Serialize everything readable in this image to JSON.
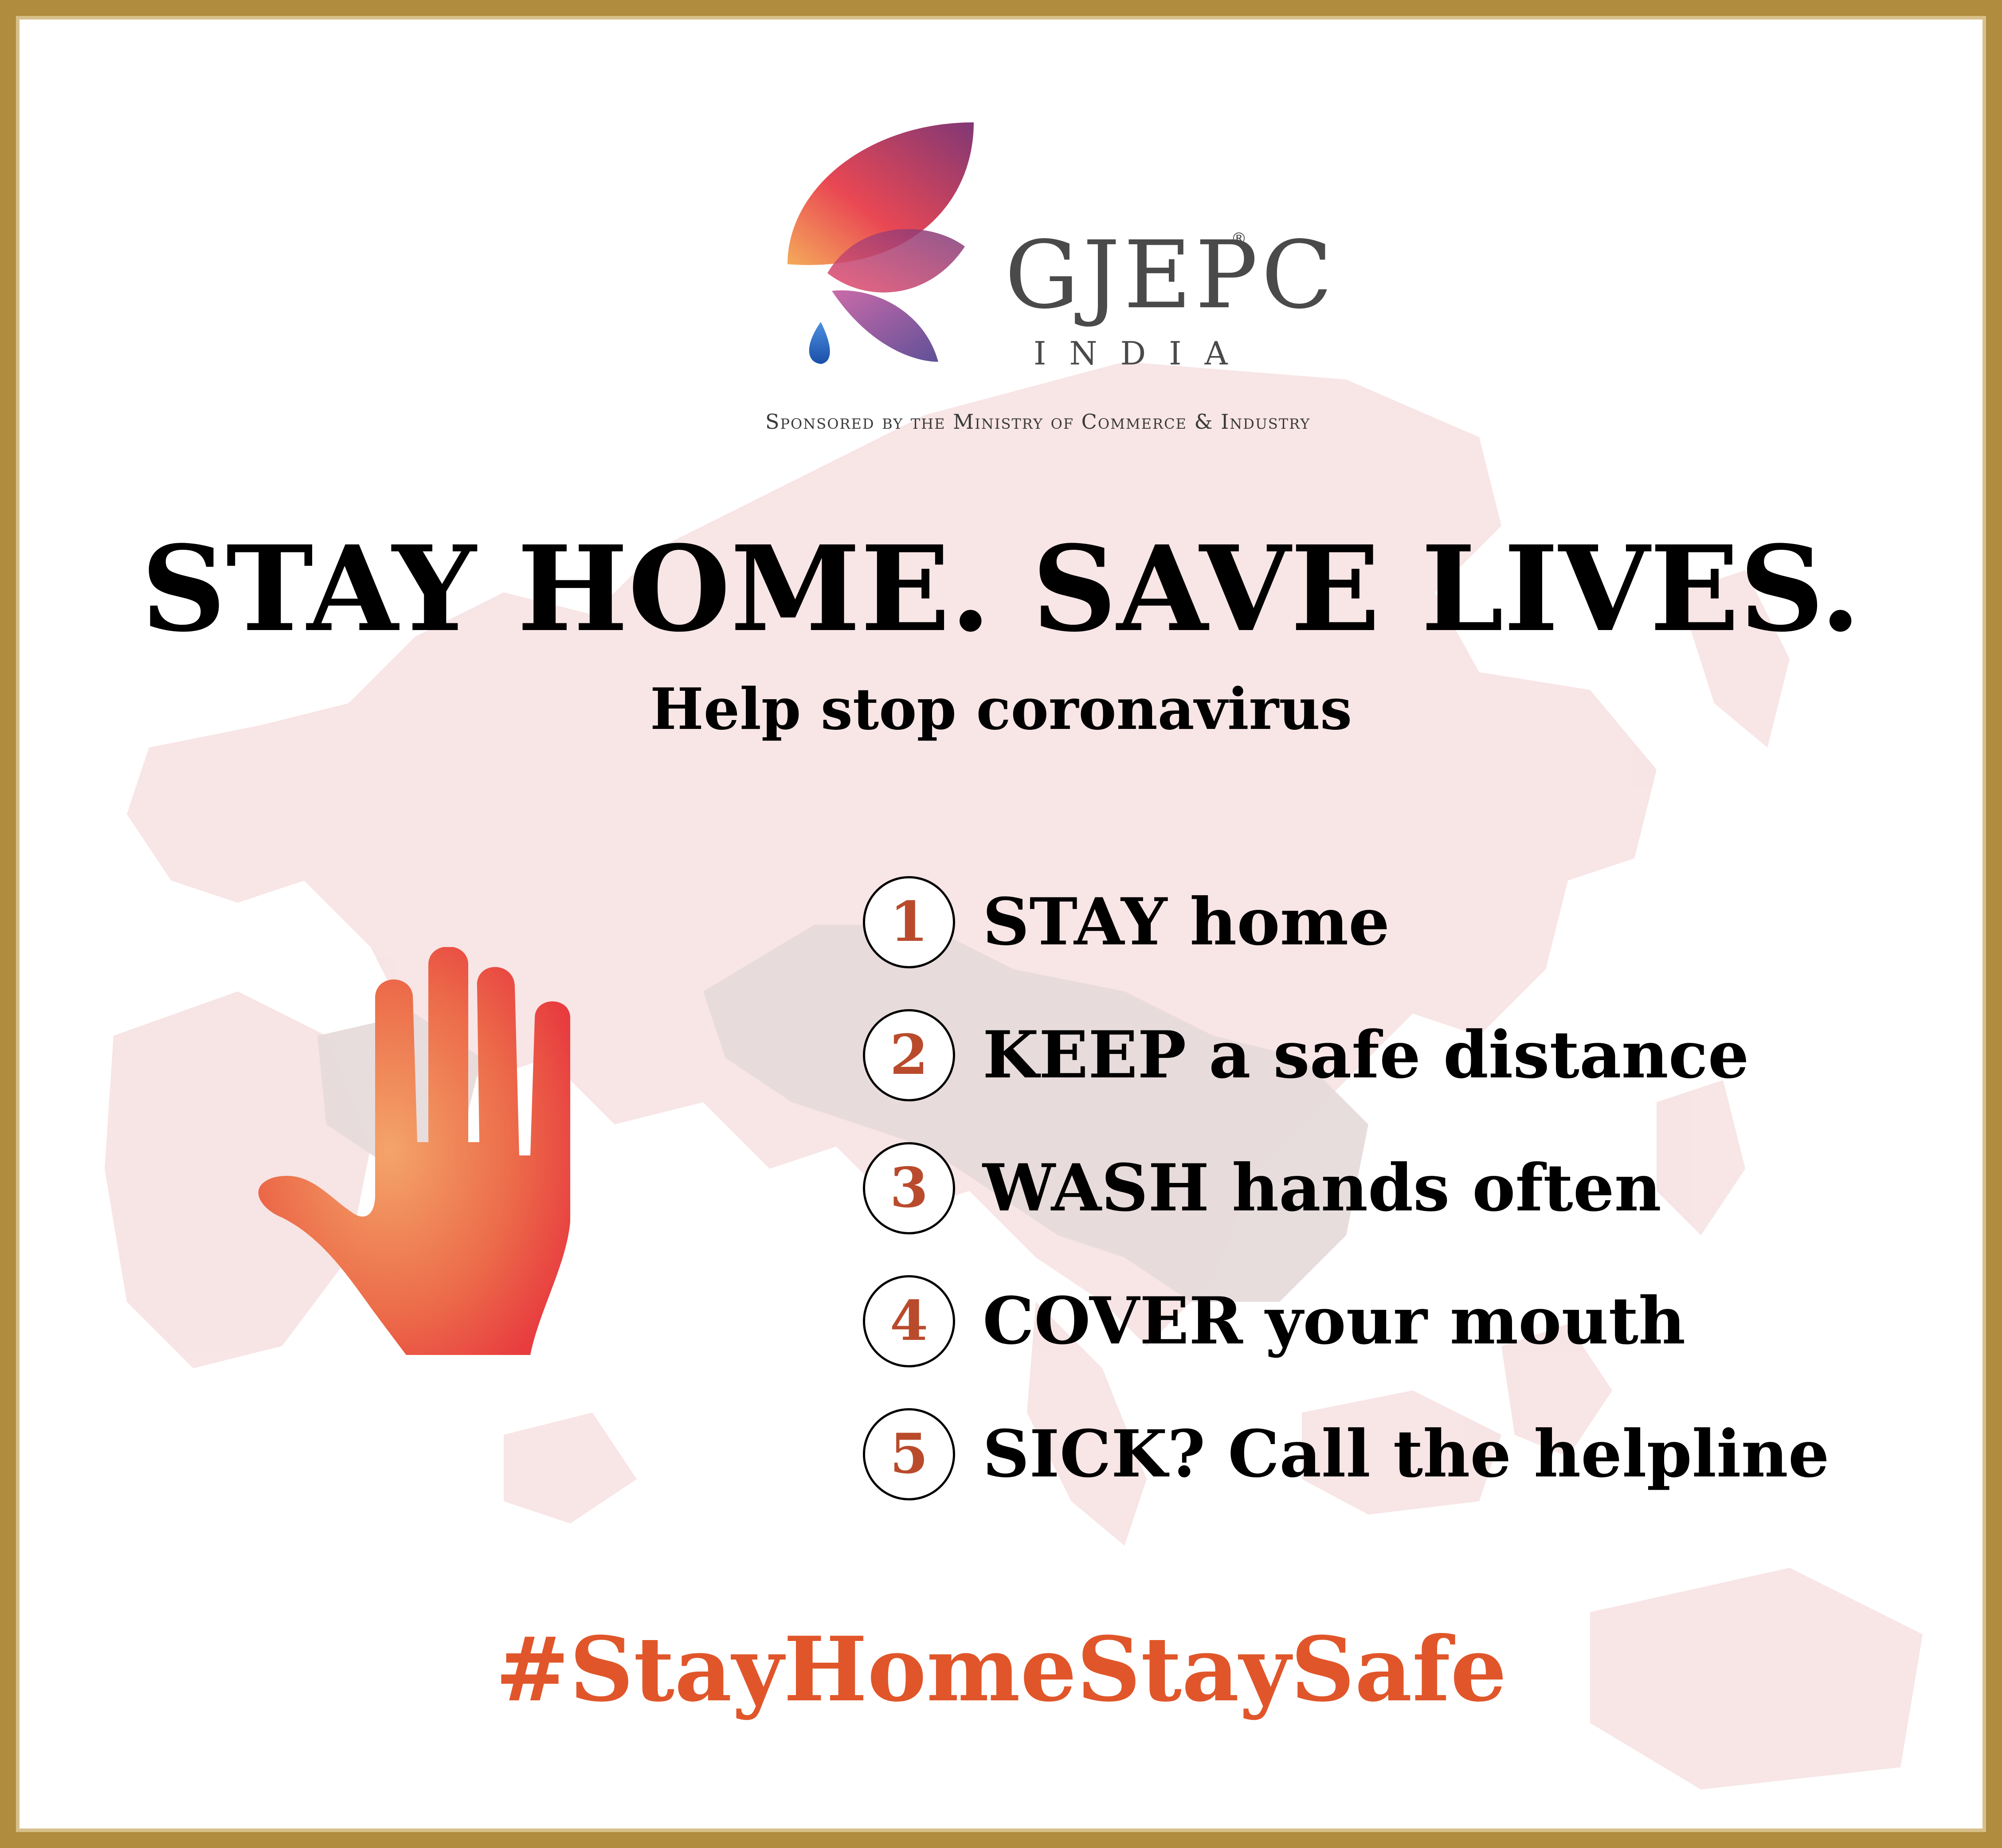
{
  "brand": {
    "name": "GJEPC",
    "registered_mark": "®",
    "country": "INDIA",
    "sponsor_line": "Sponsored by the Ministry of Commerce & Industry",
    "logo_icon": "butterfly-logo-icon"
  },
  "headline": "STAY HOME. SAVE LIVES.",
  "subheadline": "Help stop coronavirus",
  "steps": [
    {
      "number": "1",
      "text": "STAY home"
    },
    {
      "number": "2",
      "text": "KEEP a safe distance"
    },
    {
      "number": "3",
      "text": "WASH hands often"
    },
    {
      "number": "4",
      "text": "COVER your mouth"
    },
    {
      "number": "5",
      "text": "SICK? Call the helpline"
    }
  ],
  "hashtag": "#StayHomeStaySafe",
  "icons": {
    "hand": "raised-hand-icon",
    "background": "asia-map-icon"
  },
  "colors": {
    "frame_gold": "#b08d3e",
    "step_number": "#b94b2c",
    "hashtag": "#e0562a",
    "hand_gradient": [
      "#f4a46a",
      "#e94441"
    ],
    "map_tint": "#f3d4d4",
    "map_highlight": "#e3d8d8"
  }
}
